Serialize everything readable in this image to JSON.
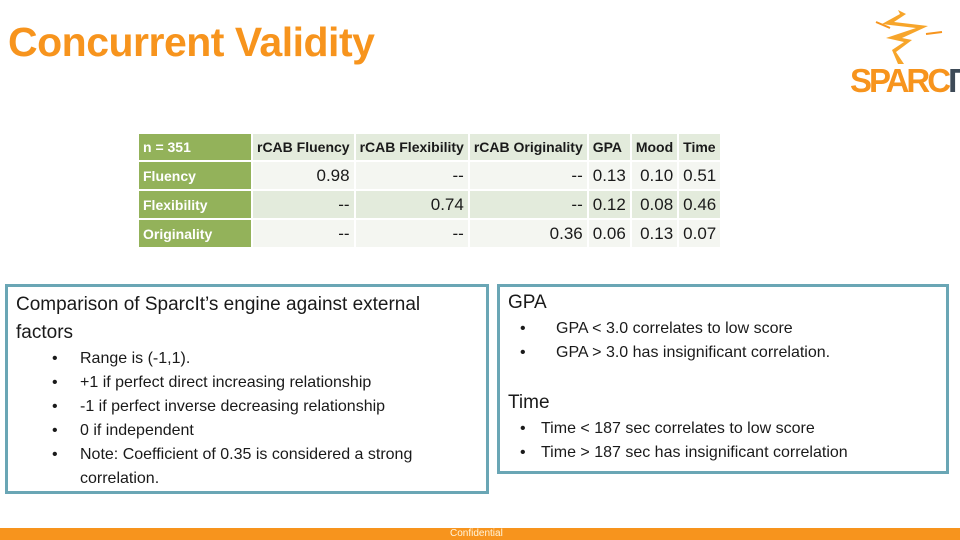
{
  "title": "Concurrent Validity",
  "logo": {
    "name": "SparcIt logo",
    "word_part1": "SPARC",
    "word_part2": "IT",
    "colors": {
      "primary": "#f7941d",
      "secondary": "#3d4a57"
    }
  },
  "table": {
    "corner": "n = 351",
    "columns": [
      "rCAB Fluency",
      "rCAB Flexibility",
      "rCAB Originality",
      "GPA",
      "Mood",
      "Time"
    ],
    "rows": [
      {
        "label": "Fluency",
        "values": [
          "0.98",
          "--",
          "--",
          "0.13",
          "0.10",
          "0.51"
        ]
      },
      {
        "label": "Flexibility",
        "values": [
          "--",
          "0.74",
          "--",
          "0.12",
          "0.08",
          "0.46"
        ]
      },
      {
        "label": "Originality",
        "values": [
          "--",
          "--",
          "0.36",
          "0.06",
          "0.13",
          "0.07"
        ]
      }
    ]
  },
  "left_box": {
    "heading": "Comparison of SparcIt’s engine against external factors",
    "bullets": [
      "Range is (-1,1).",
      "+1 if perfect direct increasing relationship",
      "-1 if perfect inverse decreasing relationship",
      "0 if independent",
      "Note: Coefficient of 0.35 is considered a strong correlation."
    ]
  },
  "right_box": {
    "gpa_heading": "GPA",
    "gpa_bullets": [
      "GPA < 3.0 correlates to low score",
      "GPA > 3.0 has insignificant correlation."
    ],
    "time_heading": "Time",
    "time_bullets": [
      "Time < 187 sec correlates to low score",
      "Time > 187 sec has insignificant correlation"
    ]
  },
  "footer": {
    "label": "Confidential"
  },
  "colors": {
    "accent": "#f7941d",
    "table_header_green": "#93b25a",
    "box_border": "#6aa6b5"
  },
  "bullet_glyph": "•"
}
